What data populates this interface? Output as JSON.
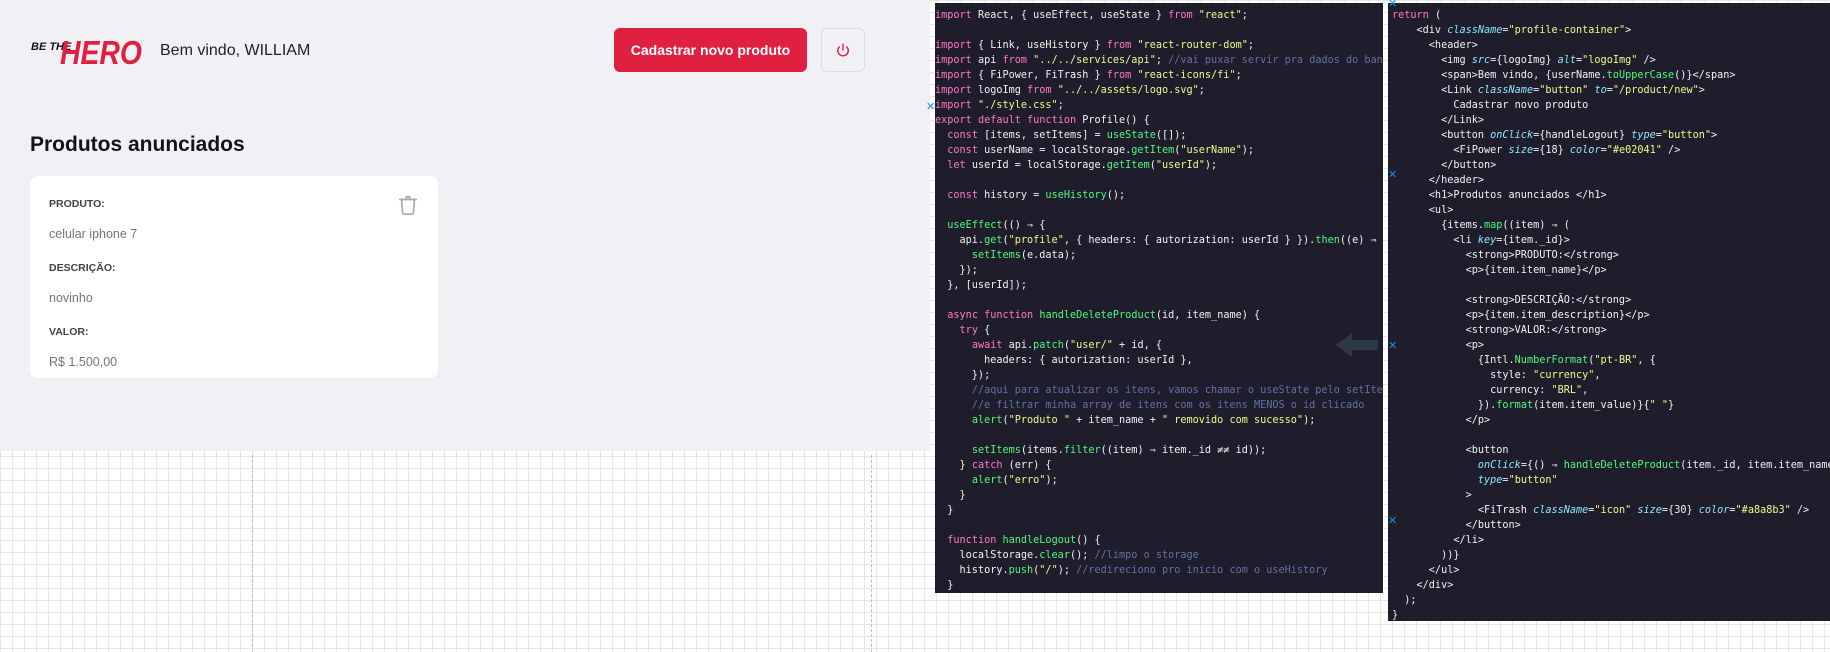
{
  "header": {
    "logo_text_top": "BE THE",
    "logo_text_main": "HERO",
    "welcome": "Bem vindo, WILLIAM",
    "new_product_label": "Cadastrar novo produto"
  },
  "page": {
    "title": "Produtos anunciados"
  },
  "product": {
    "label_product": "PRODUTO:",
    "name": "celular iphone 7",
    "label_description": "DESCRIÇÃO:",
    "description": "novinho",
    "label_value": "VALOR:",
    "value": "R$ 1.500,00"
  },
  "colors": {
    "accent": "#e02041",
    "background": "#f0f0f5",
    "trash": "#a8a8b3"
  },
  "icons": [
    "power-icon",
    "trash-icon",
    "arrow-left-icon"
  ],
  "code_left": [
    "import React, { useEffect, useState } from \"react\";",
    "",
    "import { Link, useHistory } from \"react-router-dom\";",
    "import api from \"../../services/api\"; //vai puxar servir pra dados do banco",
    "import { FiPower, FiTrash } from \"react-icons/fi\";",
    "import logoImg from \"../../assets/logo.svg\";",
    "import \"./style.css\";",
    "export default function Profile() {",
    "  const [items, setItems] = useState([]);",
    "  const userName = localStorage.getItem(\"userName\");",
    "  let userId = localStorage.getItem(\"userId\");",
    "",
    "  const history = useHistory();",
    "",
    "  useEffect(() ⇒ {",
    "    api.get(\"profile\", { headers: { autorization: userId } }).then((e) ⇒ {",
    "      setItems(e.data);",
    "    });",
    "  }, [userId]);",
    "",
    "  async function handleDeleteProduct(id, item_name) {",
    "    try {",
    "      await api.patch(\"user/\" + id, {",
    "        headers: { autorization: userId },",
    "      });",
    "      //aqui para atualizar os itens, vamos chamar o useState pelo setItens",
    "      //e filtrar minha array de itens com os itens MENOS o id clicado",
    "      alert(\"Produto \" + item_name + \" removido com sucesso\");",
    "",
    "      setItems(items.filter((item) ⇒ item._id ≠≠ id));",
    "    } catch (err) {",
    "      alert(\"erro\");",
    "    }",
    "  }",
    "",
    "  function handleLogout() {",
    "    localStorage.clear(); //limpo o storage",
    "    history.push(\"/\"); //redireciono pro inicio com o useHistory",
    "  }"
  ],
  "code_right": [
    "return (",
    "    <div className=\"profile-container\">",
    "      <header>",
    "        <img src={logoImg} alt=\"logoImg\" />",
    "        <span>Bem vindo, {userName.toUpperCase()}</span>",
    "        <Link className=\"button\" to=\"/product/new\">",
    "          Cadastrar novo produto",
    "        </Link>",
    "        <button onClick={handleLogout} type=\"button\">",
    "          <FiPower size={18} color=\"#e02041\" />",
    "        </button>",
    "      </header>",
    "      <h1>Produtos anunciados </h1>",
    "      <ul>",
    "        {items.map((item) ⇒ (",
    "          <li key={item._id}>",
    "            <strong>PRODUTO:</strong>",
    "            <p>{item.item_name}</p>",
    "",
    "            <strong>DESCRIÇÃO:</strong>",
    "            <p>{item.item_description}</p>",
    "            <strong>VALOR:</strong>",
    "            <p>",
    "              {Intl.NumberFormat(\"pt-BR\", {",
    "                style: \"currency\",",
    "                currency: \"BRL\",",
    "              }).format(item.item_value)}{\" \"}",
    "            </p>",
    "",
    "            <button",
    "              onClick={() ⇒ handleDeleteProduct(item._id, item.item_name)}",
    "              type=\"button\"",
    "            >",
    "              <FiTrash className=\"icon\" size={30} color=\"#a8a8b3\" />",
    "            </button>",
    "          </li>",
    "        ))}",
    "      </ul>",
    "    </div>",
    "  );",
    "}"
  ]
}
